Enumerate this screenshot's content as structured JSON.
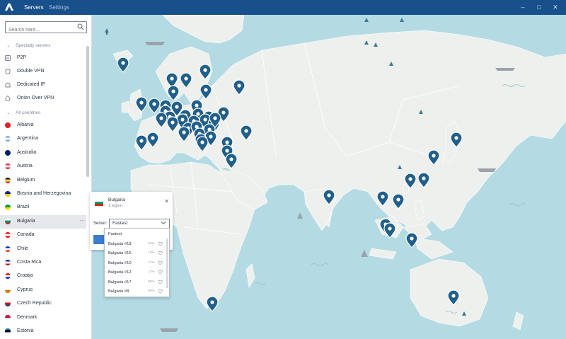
{
  "titlebar": {
    "tabs": [
      {
        "label": "Servers",
        "active": true
      },
      {
        "label": "Settings",
        "active": false
      }
    ],
    "controls": [
      "minimize",
      "maximize",
      "close"
    ]
  },
  "sidebar": {
    "search_placeholder": "Search here...",
    "specialty_header": "Specialty servers",
    "specialty": [
      {
        "label": "P2P",
        "icon": "p2p-icon"
      },
      {
        "label": "Double VPN",
        "icon": "double-vpn-icon"
      },
      {
        "label": "Dedicated IP",
        "icon": "dedicated-ip-icon"
      },
      {
        "label": "Onion Over VPN",
        "icon": "onion-icon"
      }
    ],
    "countries_header": "All countries",
    "countries": [
      {
        "label": "Albania",
        "colors": [
          "#e41e20",
          "#e41e20"
        ]
      },
      {
        "label": "Argentina",
        "colors": [
          "#74acdf",
          "#ffffff",
          "#74acdf"
        ]
      },
      {
        "label": "Australia",
        "colors": [
          "#012169",
          "#012169"
        ]
      },
      {
        "label": "Austria",
        "colors": [
          "#ed2939",
          "#ffffff",
          "#ed2939"
        ]
      },
      {
        "label": "Belgium",
        "colors": [
          "#000000",
          "#fae042",
          "#ed2939"
        ]
      },
      {
        "label": "Bosnia and Herzegovina",
        "colors": [
          "#002395",
          "#fecb00"
        ]
      },
      {
        "label": "Brazil",
        "colors": [
          "#009c3b",
          "#ffdf00"
        ]
      },
      {
        "label": "Bulgaria",
        "colors": [
          "#ffffff",
          "#00966e",
          "#d62612"
        ],
        "selected": true
      },
      {
        "label": "Canada",
        "colors": [
          "#ff0000",
          "#ffffff",
          "#ff0000"
        ]
      },
      {
        "label": "Chile",
        "colors": [
          "#0039a6",
          "#ffffff",
          "#d52b1e"
        ]
      },
      {
        "label": "Costa Rica",
        "colors": [
          "#002b7f",
          "#ffffff",
          "#ce1126"
        ]
      },
      {
        "label": "Croatia",
        "colors": [
          "#ff0000",
          "#ffffff",
          "#171796"
        ]
      },
      {
        "label": "Cyprus",
        "colors": [
          "#ffffff",
          "#d57800"
        ]
      },
      {
        "label": "Czech Republic",
        "colors": [
          "#ffffff",
          "#d7141a",
          "#11457e"
        ]
      },
      {
        "label": "Denmark",
        "colors": [
          "#c8102e",
          "#ffffff"
        ]
      },
      {
        "label": "Estonia",
        "colors": [
          "#0072ce",
          "#000000",
          "#ffffff"
        ]
      }
    ],
    "more_label": "···"
  },
  "popup": {
    "title": "Bulgaria",
    "subtitle": "1 region",
    "server_label": "Server:",
    "selected_server": "Fastest",
    "options": [
      {
        "name": "Fastest",
        "load": ""
      },
      {
        "name": "Bulgaria #18",
        "load": "10%"
      },
      {
        "name": "Bulgaria #15",
        "load": "13%"
      },
      {
        "name": "Bulgaria #10",
        "load": "17%"
      },
      {
        "name": "Bulgaria #12",
        "load": "17%"
      },
      {
        "name": "Bulgaria #17",
        "load": "09%"
      },
      {
        "name": "Bulgaria #8",
        "load": "09%"
      }
    ]
  },
  "colors": {
    "accent": "#17508a",
    "pin": "#215f8b",
    "ocean": "#b4dbe4",
    "land": "#eef0ee",
    "button": "#3a7ccf"
  }
}
